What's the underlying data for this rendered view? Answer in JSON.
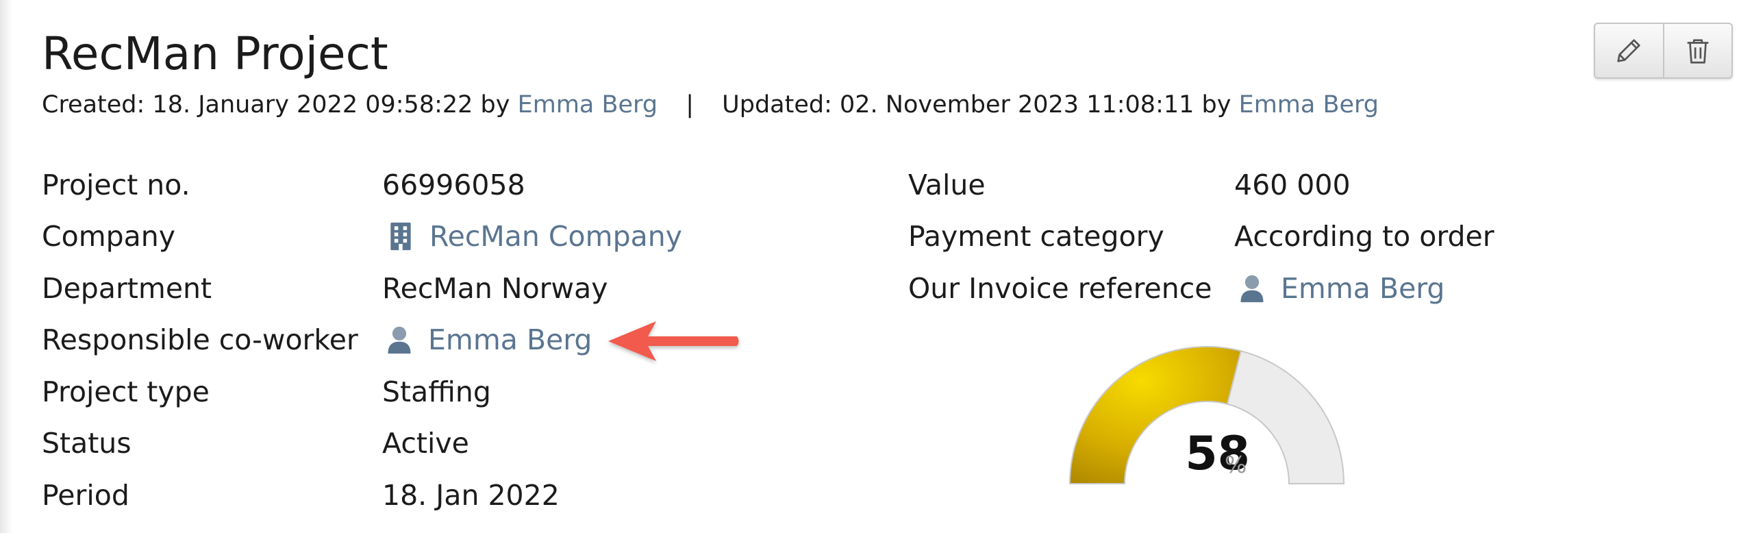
{
  "header": {
    "title": "RecMan Project",
    "created_prefix": "Created: 18. January 2022 09:58:22 by",
    "created_by": "Emma Berg",
    "separator": "|",
    "updated_prefix": "Updated: 02. November 2023 11:08:11 by",
    "updated_by": "Emma Berg"
  },
  "toolbar": {
    "edit_icon": "pencil-icon",
    "delete_icon": "trash-icon"
  },
  "left_fields": [
    {
      "label": "Project no.",
      "value": "66996058"
    },
    {
      "label": "Company",
      "value": "RecMan Company",
      "icon": "building-icon"
    },
    {
      "label": "Department",
      "value": "RecMan Norway"
    },
    {
      "label": "Responsible co-worker",
      "value": "Emma Berg",
      "icon": "person-icon"
    },
    {
      "label": "Project type",
      "value": "Staffing"
    },
    {
      "label": "Status",
      "value": "Active"
    },
    {
      "label": "Period",
      "value": "18. Jan 2022"
    }
  ],
  "right_fields": [
    {
      "label": "Value",
      "value": "460 000"
    },
    {
      "label": "Payment category",
      "value": "According to order"
    },
    {
      "label": "Our Invoice reference",
      "value": "Emma Berg",
      "icon": "person-icon"
    }
  ],
  "gauge": {
    "value": "58",
    "unit": "%",
    "fraction": 0.58,
    "fill_color": "#e0b800",
    "track_color": "#ececec"
  },
  "annotation": {
    "icon": "arrow-left-icon",
    "color": "#f25a4e"
  }
}
